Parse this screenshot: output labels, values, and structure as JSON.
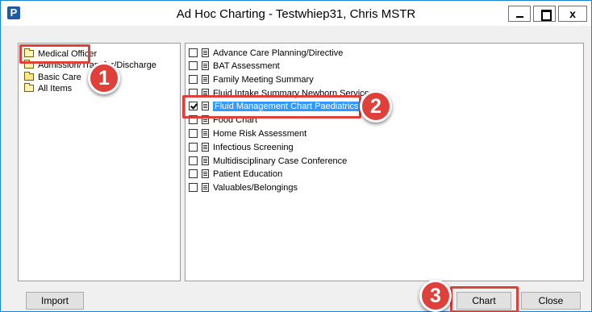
{
  "window": {
    "app_icon": "P",
    "title": "Ad Hoc Charting - Testwhiep31, Chris   MSTR"
  },
  "folders": [
    {
      "label": "Medical Officer",
      "icon": "folder-icon"
    },
    {
      "label": "Admission/Transfer/Discharge",
      "icon": "folder-icon"
    },
    {
      "label": "Basic Care",
      "icon": "folder-open-icon"
    },
    {
      "label": "All Items",
      "icon": "folder-icon"
    }
  ],
  "forms": [
    {
      "label": "Advance Care Planning/Directive",
      "checked": false
    },
    {
      "label": "BAT Assessment",
      "checked": false
    },
    {
      "label": "Family Meeting Summary",
      "checked": false
    },
    {
      "label": "Fluid Intake Summary Newborn Services",
      "checked": false
    },
    {
      "label": "Fluid Management Chart Paediatrics",
      "checked": true,
      "selected": true
    },
    {
      "label": "Food Chart",
      "checked": false
    },
    {
      "label": "Home Risk Assessment",
      "checked": false
    },
    {
      "label": "Infectious Screening",
      "checked": false
    },
    {
      "label": "Multidisciplinary Case Conference",
      "checked": false
    },
    {
      "label": "Patient Education",
      "checked": false
    },
    {
      "label": "Valuables/Belongings",
      "checked": false
    }
  ],
  "buttons": {
    "import": "Import",
    "chart": "Chart",
    "close": "Close"
  },
  "annotations": {
    "step1": "1",
    "step2": "2",
    "step3": "3",
    "color": "#e0403a"
  }
}
